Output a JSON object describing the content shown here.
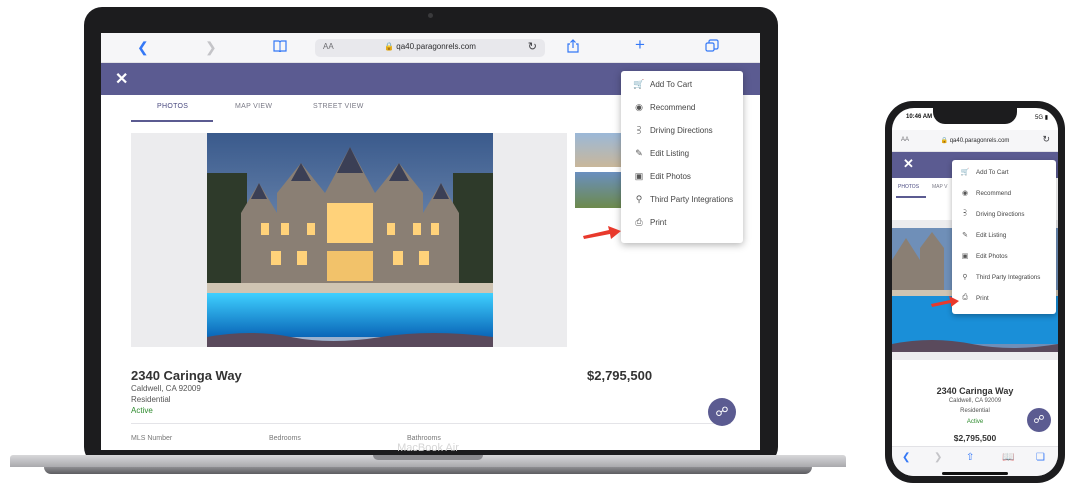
{
  "colors": {
    "header": "#5b5b91",
    "active": "#2e8b2e",
    "safari_blue": "#3478f6",
    "arrow": "#e8392c"
  },
  "laptop": {
    "label": "MacBook Air",
    "browser": {
      "aa": "AA",
      "url": "qa40.paragonrels.com"
    },
    "tabs": [
      "PHOTOS",
      "MAP VIEW",
      "STREET VIEW"
    ],
    "listing": {
      "address": "2340 Caringa Way",
      "city": "Caldwell, CA 92009",
      "type": "Residential",
      "status": "Active",
      "price": "$2,795,500"
    },
    "fields": [
      "MLS Number",
      "Bedrooms",
      "Bathrooms"
    ]
  },
  "menu": {
    "items": [
      {
        "label": "Add To Cart",
        "icon": "cart-icon"
      },
      {
        "label": "Recommend",
        "icon": "recommend-icon"
      },
      {
        "label": "Driving Directions",
        "icon": "directions-icon"
      },
      {
        "label": "Edit Listing",
        "icon": "pencil-icon"
      },
      {
        "label": "Edit Photos",
        "icon": "photo-icon"
      },
      {
        "label": "Third Party Integrations",
        "icon": "integrations-icon"
      },
      {
        "label": "Print",
        "icon": "print-icon"
      }
    ]
  },
  "phone": {
    "time": "10:46 AM",
    "signal": "5G",
    "browser": {
      "aa": "AA",
      "url": "qa40.paragonrels.com"
    },
    "tabs": [
      "PHOTOS",
      "MAP V"
    ],
    "listing": {
      "address": "2340 Caringa Way",
      "city": "Caldwell, CA 92009",
      "type": "Residential",
      "status": "Active",
      "price": "$2,795,500"
    }
  }
}
